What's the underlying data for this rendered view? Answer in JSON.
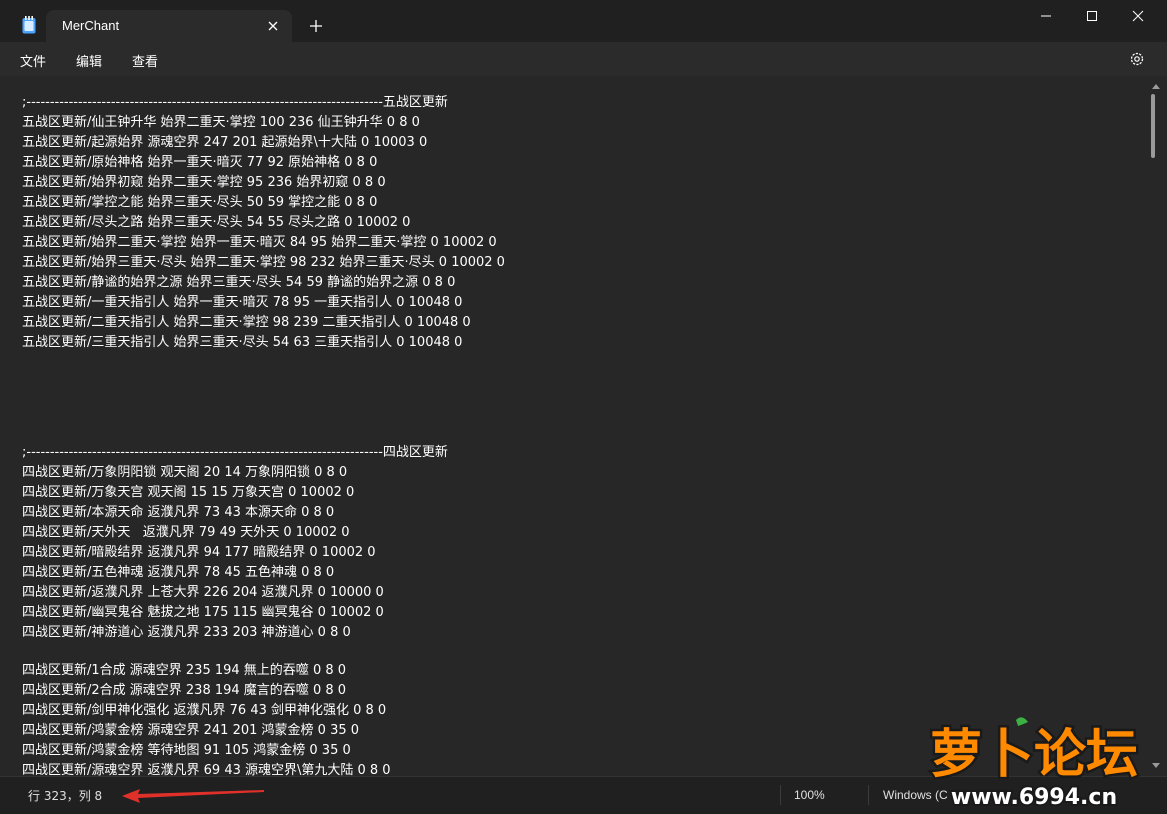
{
  "tab": {
    "title": "MerChant"
  },
  "menu": {
    "file": "文件",
    "edit": "编辑",
    "view": "查看"
  },
  "editor": {
    "lines": [
      ";----------------------------------------------------------------------------五战区更新",
      "五战区更新/仙王钟升华 始界二重天·掌控 100 236 仙王钟升华 0 8 0",
      "五战区更新/起源始界 源魂空界 247 201 起源始界\\十大陆 0 10003 0",
      "五战区更新/原始神格 始界一重天·暗灭 77 92 原始神格 0 8 0",
      "五战区更新/始界初窥 始界二重天·掌控 95 236 始界初窥 0 8 0",
      "五战区更新/掌控之能 始界三重天·尽头 50 59 掌控之能 0 8 0",
      "五战区更新/尽头之路 始界三重天·尽头 54 55 尽头之路 0 10002 0",
      "五战区更新/始界二重天·掌控 始界一重天·暗灭 84 95 始界二重天·掌控 0 10002 0",
      "五战区更新/始界三重天·尽头 始界二重天·掌控 98 232 始界三重天·尽头 0 10002 0",
      "五战区更新/静谧的始界之源 始界三重天·尽头 54 59 静谧的始界之源 0 8 0",
      "五战区更新/一重天指引人 始界一重天·暗灭 78 95 一重天指引人 0 10048 0",
      "五战区更新/二重天指引人 始界二重天·掌控 98 239 二重天指引人 0 10048 0",
      "五战区更新/三重天指引人 始界三重天·尽头 54 63 三重天指引人 0 10048 0",
      "",
      ";----------------------------------------------------------------------------四战区更新",
      "四战区更新/万象阴阳锁 观天阁 20 14 万象阴阳锁 0 8 0",
      "四战区更新/万象天宫 观天阁 15 15 万象天宫 0 10002 0",
      "四战区更新/本源天命 返濮凡界 73 43 本源天命 0 8 0",
      "四战区更新/天外天   返濮凡界 79 49 天外天 0 10002 0",
      "四战区更新/暗殿结界 返濮凡界 94 177 暗殿结界 0 10002 0",
      "四战区更新/五色神魂 返濮凡界 78 45 五色神魂 0 8 0",
      "四战区更新/返濮凡界 上苍大界 226 204 返濮凡界 0 10000 0",
      "四战区更新/幽冥鬼谷 魅拔之地 175 115 幽冥鬼谷 0 10002 0",
      "四战区更新/神游道心 返濮凡界 233 203 神游道心 0 8 0",
      "",
      "四战区更新/1合成 源魂空界 235 194 無上的吞噬 0 8 0",
      "四战区更新/2合成 源魂空界 238 194 魔言的吞噬 0 8 0",
      "四战区更新/剑甲神化强化 返濮凡界 76 43 剑甲神化强化 0 8 0",
      "四战区更新/鸿蒙金榜 源魂空界 241 201 鸿蒙金榜 0 35 0",
      "四战区更新/鸿蒙金榜 等待地图 91 105 鸿蒙金榜 0 35 0",
      "四战区更新/源魂空界 返濮凡界 69 43 源魂空界\\第九大陆 0 8 0"
    ]
  },
  "status": {
    "position": "行 323，列 8",
    "zoom": "100%",
    "eol": "Windows (C"
  },
  "watermark": {
    "brand": "萝卜论坛",
    "site": "www.6994.cn"
  },
  "colors": {
    "bg": "#272727",
    "titlebar": "#202020",
    "arrow": "#e0302a",
    "watermark_orange": "#ff8a00"
  },
  "icons": {
    "app": "notepad-icon",
    "close": "close-icon",
    "add": "plus-icon",
    "settings": "gear-icon"
  }
}
